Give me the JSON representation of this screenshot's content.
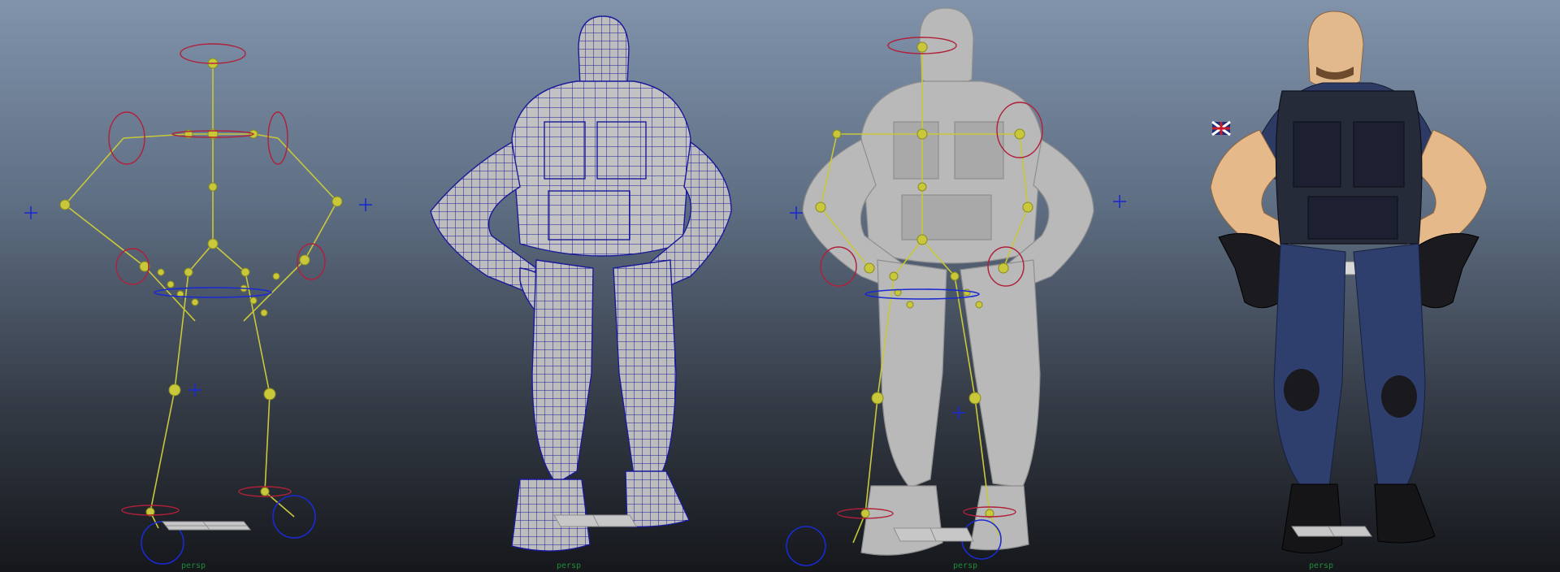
{
  "viewport": {
    "background_top": "#8093ab",
    "background_bottom": "#15171b"
  },
  "panels": [
    {
      "id": "skeleton-rig",
      "camera_label": "persp"
    },
    {
      "id": "wireframe-mesh",
      "camera_label": "persp"
    },
    {
      "id": "skinned-rig",
      "camera_label": "persp"
    },
    {
      "id": "textured-model",
      "camera_label": "persp"
    }
  ],
  "colors": {
    "joint_yellow": "#c8c83a",
    "control_red": "#b0203a",
    "locator_blue": "#1a2ad0",
    "wire_blue": "#1a1a9a",
    "mesh_gray": "#b9b9b9",
    "camera_label_green": "#1f8a3a"
  },
  "icons": {
    "locator": "locator-cross-icon",
    "ground_grid": "grid-plane-icon"
  }
}
